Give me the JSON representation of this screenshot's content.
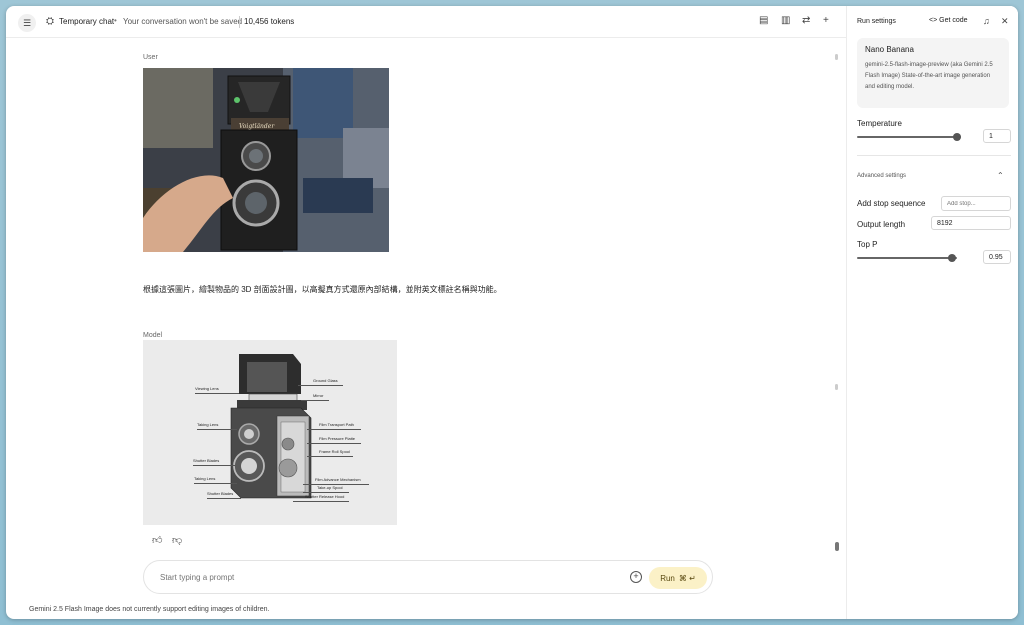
{
  "header": {
    "title": "Temporary chat",
    "note": "Your conversation won't be saved",
    "tokens": "10,456 tokens"
  },
  "chat": {
    "user_role": "User",
    "user_prompt": "根據這張圖片，繪製物品的 3D 剖面設計圖，以高擬真方式還原內部結構，並附英文標註名稱與功能。",
    "model_role": "Model",
    "photo_brand": "Voigtländer",
    "diagram_labels": {
      "viewing_lens": "Viewing Lens",
      "taking_lens": "Taking Lens",
      "shutter_blades_1": "Shutter Blades",
      "taking_lens_2": "Taking Lens",
      "shutter_blades_2": "Shutter Blades",
      "ground_glass": "Ground Glass",
      "mirror": "Mirror",
      "film_transport": "Film Transport Path",
      "film_pressure": "Film Pressure Platte",
      "frame_roll": "Frame Roll Spool",
      "film_advance": "Film Advance Mechanism",
      "take_up": "Take-up Spool",
      "shutter_release": "Shutter Release Hood"
    }
  },
  "input": {
    "placeholder": "Start typing a prompt",
    "run_label": "Run",
    "run_shortcut": "⌘ ↵"
  },
  "disclaimer": "Gemini 2.5 Flash Image does not currently support editing images of children.",
  "panel": {
    "title": "Run settings",
    "get_code": "Get code",
    "model_name": "Nano Banana",
    "model_desc": "gemini-2.5-flash-image-preview (aka Gemini 2.5 Flash Image) State-of-the-art image generation and editing model.",
    "temperature_label": "Temperature",
    "temperature_value": "1",
    "temperature_level": 0.96,
    "advanced_label": "Advanced settings",
    "stop_label": "Add stop sequence",
    "stop_placeholder": "Add stop...",
    "output_label": "Output length",
    "output_value": "8192",
    "topp_label": "Top P",
    "topp_value": "0.95",
    "topp_level": 0.95
  }
}
